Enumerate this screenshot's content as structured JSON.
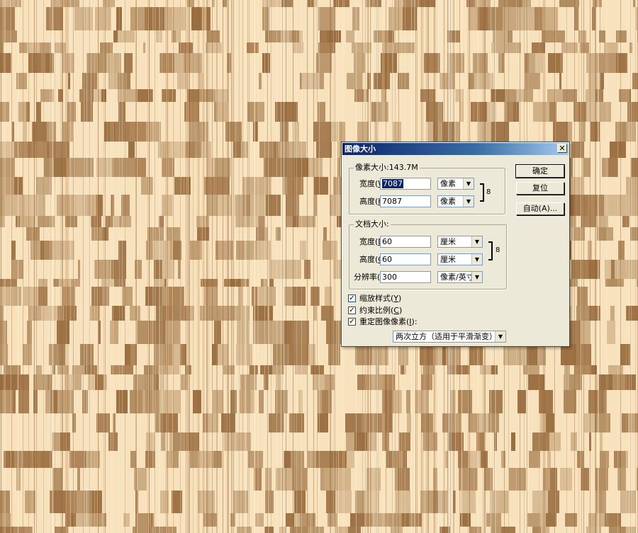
{
  "colors": {
    "texture_light": "#f7e2bd",
    "texture_dark": "#8a5a2b",
    "title_bar": "#0a246a",
    "dialog_bg": "#ece9d8"
  },
  "dialog": {
    "title": "图像大小",
    "close_glyph": "✕",
    "pixel_dims": {
      "title": "像素大小:143.7M",
      "width_label": "宽度(",
      "width_key": "W",
      "width_label_end": "):",
      "width_value": "7087",
      "width_unit": "像素",
      "height_label": "高度(",
      "height_key": "H",
      "height_label_end": "):",
      "height_value": "7087",
      "height_unit": "像素"
    },
    "doc_size": {
      "title": "文档大小:",
      "width_label": "宽度(",
      "width_key": "D",
      "width_label_end": "):",
      "width_value": "60",
      "width_unit": "厘米",
      "height_label": "高度(",
      "height_key": "G",
      "height_label_end": "):",
      "height_value": "60",
      "height_unit": "厘米",
      "res_label": "分辨率(",
      "res_key": "R",
      "res_label_end": "):",
      "res_value": "300",
      "res_unit": "像素/英寸"
    },
    "buttons": {
      "ok": "确定",
      "reset": "复位",
      "auto": "自动(A)..."
    },
    "options": {
      "scale_styles": {
        "label": "缩放样式(",
        "key": "Y",
        "end": ")",
        "checked": true
      },
      "constrain": {
        "label": "约束比例(",
        "key": "C",
        "end": ")",
        "checked": true
      },
      "resample": {
        "label": "重定图像像素(",
        "key": "I",
        "end": "):",
        "checked": true
      },
      "resample_method": "两次立方（适用于平滑渐变）"
    },
    "check_glyph": "✓",
    "arrow_glyph": "▼",
    "chain_glyph": "8"
  }
}
